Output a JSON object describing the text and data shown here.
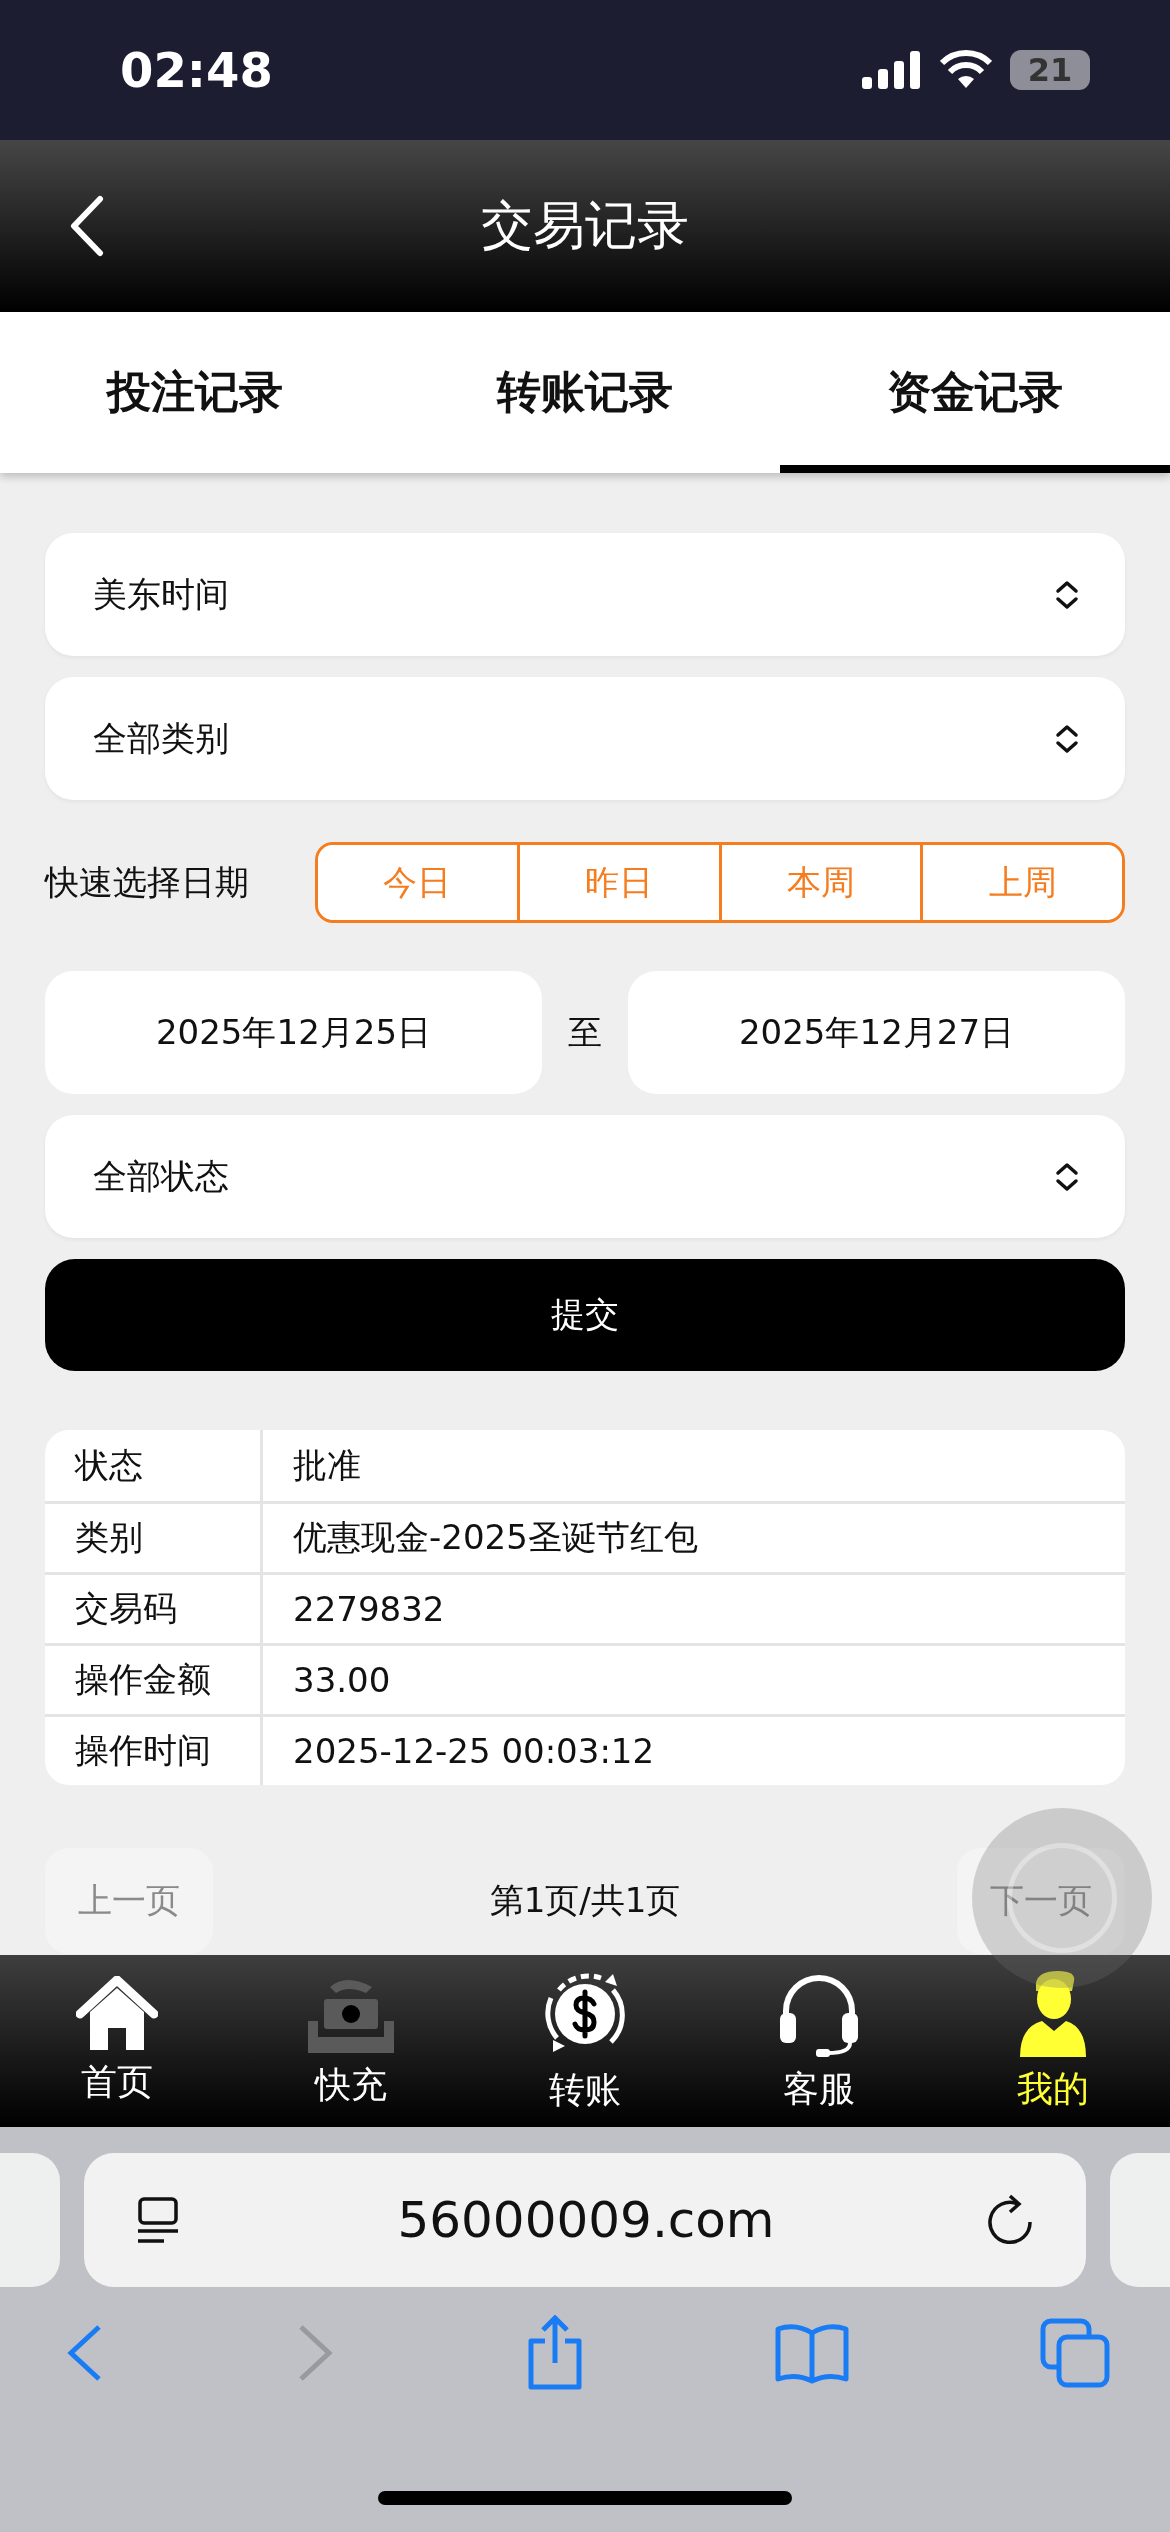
{
  "status_bar": {
    "time": "02:48",
    "battery": "21"
  },
  "header": {
    "title": "交易记录"
  },
  "tabs": [
    {
      "label": "投注记录",
      "selected": false
    },
    {
      "label": "转账记录",
      "selected": false
    },
    {
      "label": "资金记录",
      "selected": true
    }
  ],
  "filters": {
    "timezone": "美东时间",
    "category": "全部类别",
    "quick_label": "快速选择日期",
    "quick_dates": [
      "今日",
      "昨日",
      "本周",
      "上周"
    ],
    "date_from": "2025年12月25日",
    "date_separator": "至",
    "date_to": "2025年12月27日",
    "status": "全部状态",
    "submit": "提交"
  },
  "record": [
    {
      "label": "状态",
      "value": "批准"
    },
    {
      "label": "类别",
      "value": "优惠现金-2025圣诞节红包"
    },
    {
      "label": "交易码",
      "value": "2279832"
    },
    {
      "label": "操作金额",
      "value": "33.00"
    },
    {
      "label": "操作时间",
      "value": "2025-12-25 00:03:12"
    }
  ],
  "pagination": {
    "prev": {
      "label": "上一页",
      "disabled": true
    },
    "info": "第1页/共1页",
    "next": {
      "label": "下一页",
      "disabled": true
    }
  },
  "nav": [
    {
      "kind": "home",
      "label": "首页",
      "selected": false,
      "dimmed": false
    },
    {
      "kind": "deposit",
      "label": "快充",
      "selected": false,
      "dimmed": true
    },
    {
      "kind": "transfer",
      "label": "转账",
      "selected": false,
      "dimmed": false
    },
    {
      "kind": "support",
      "label": "客服",
      "selected": false,
      "dimmed": false
    },
    {
      "kind": "profile",
      "label": "我的",
      "selected": true,
      "dimmed": false
    }
  ],
  "browser": {
    "url": "56000009.com",
    "back_disabled": false,
    "forward_disabled": true
  }
}
